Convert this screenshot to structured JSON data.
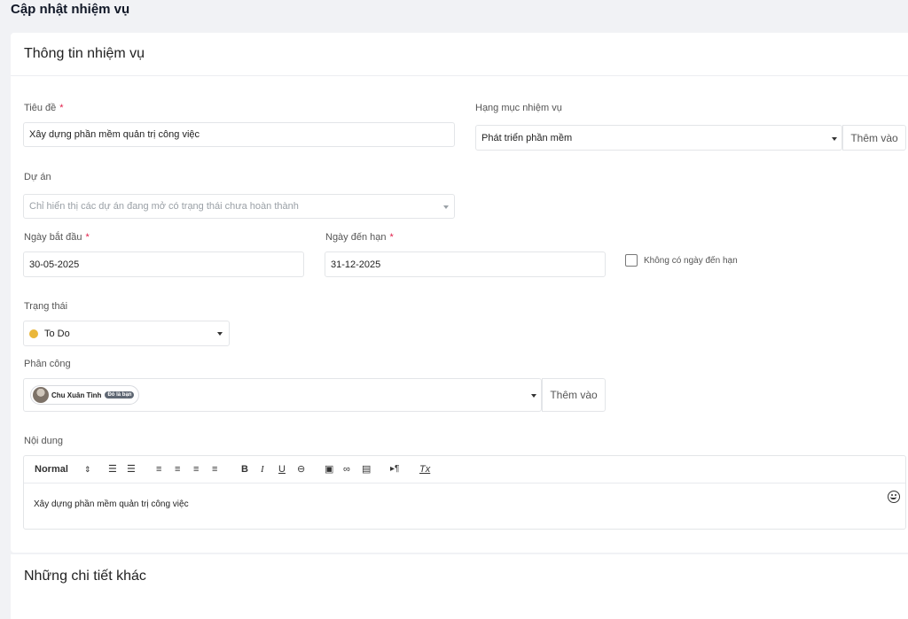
{
  "page": {
    "title": "Cập nhật nhiệm vụ"
  },
  "section_info": {
    "title": "Thông tin nhiệm vụ"
  },
  "fields": {
    "title_label": "Tiêu đề",
    "title_value": "Xây dựng phần mềm quản trị công việc",
    "category_label": "Hạng mục nhiệm vụ",
    "category_value": "Phát triển phần mềm",
    "category_add": "Thêm vào",
    "project_label": "Dự án",
    "project_placeholder": "Chỉ hiển thị các dự án đang mở có trạng thái chưa hoàn thành",
    "start_label": "Ngày bắt đầu",
    "start_value": "30-05-2025",
    "due_label": "Ngày đến hạn",
    "due_value": "31-12-2025",
    "no_due_label": "Không có ngày đến hạn",
    "status_label": "Trạng thái",
    "status_value": "To Do",
    "assign_label": "Phân công",
    "assignee_name": "Chu Xuân Tình",
    "assignee_badge": "Đó là bạn",
    "assign_add": "Thêm vào",
    "content_label": "Nội dung",
    "content_value": "Xây dựng phần mềm quản trị công việc",
    "required_mark": "*"
  },
  "editor": {
    "heading_select": "Normal",
    "icons": [
      "ordered-list-icon",
      "bullet-list-icon",
      "align-left-icon",
      "align-center-icon",
      "align-right-icon",
      "align-justify-icon",
      "bold-icon",
      "italic-icon",
      "underline-icon",
      "strike-icon",
      "image-icon",
      "link-icon",
      "video-icon",
      "text-direction-icon",
      "clear-format-icon",
      "emoji-icon"
    ]
  },
  "section_other": {
    "title": "Những chi tiết khác"
  },
  "colors": {
    "status_dot": "#eab73a",
    "required": "#e11d48"
  }
}
